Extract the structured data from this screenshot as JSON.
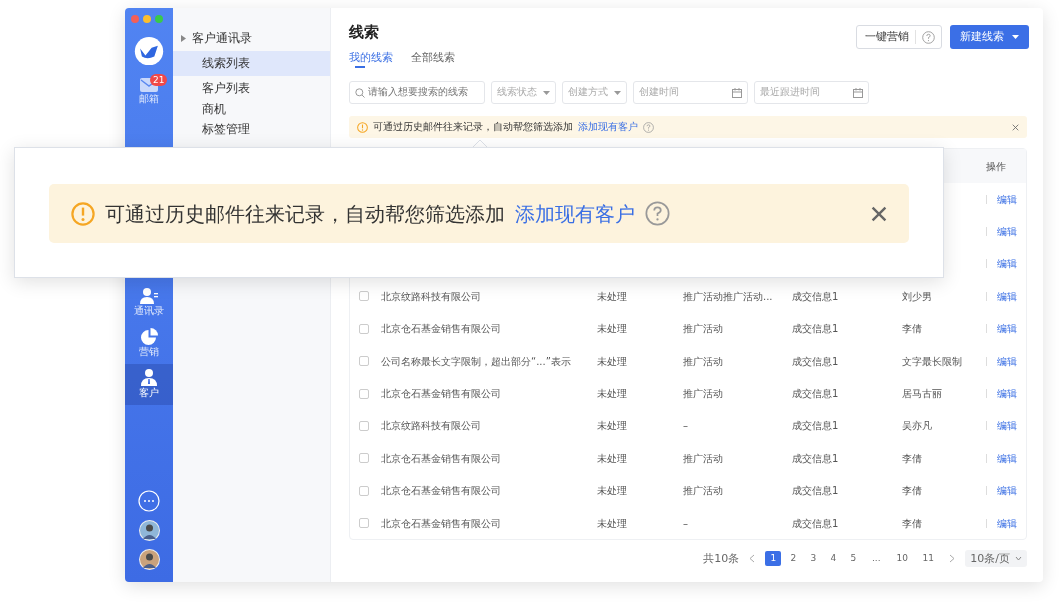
{
  "rail": {
    "items": [
      {
        "kind": "mail",
        "label": "邮箱",
        "badge": "21",
        "selected": false
      },
      {
        "kind": "contacts",
        "label": "通讯录",
        "selected": false
      },
      {
        "kind": "chart",
        "label": "营销",
        "selected": false
      },
      {
        "kind": "customer",
        "label": "客户",
        "selected": true
      }
    ]
  },
  "nav": {
    "group": "客户通讯录",
    "items": [
      {
        "label": "线索列表",
        "selected": true
      },
      {
        "label": "客户列表",
        "selected": false
      },
      {
        "label": "商机",
        "selected": false
      },
      {
        "label": "标签管理",
        "selected": false
      }
    ]
  },
  "page": {
    "title": "线索",
    "marketing_button": "一键营销",
    "create_button": "新建线索",
    "tabs": [
      {
        "label": "我的线索",
        "selected": true
      },
      {
        "label": "全部线索",
        "selected": false
      }
    ],
    "filters": [
      {
        "kind": "search",
        "placeholder": "请输入想要搜索的线索"
      },
      {
        "kind": "select",
        "placeholder": "线索状态"
      },
      {
        "kind": "select",
        "placeholder": "创建方式"
      },
      {
        "kind": "date",
        "placeholder": "创建时间"
      },
      {
        "kind": "date",
        "placeholder": "最近跟进时间"
      }
    ],
    "alert": {
      "text": "可通过历史邮件往来记录，自动帮您筛选添加",
      "link": "添加现有客户"
    }
  },
  "table": {
    "action_column": "操作",
    "rows": [
      {
        "action": "编辑"
      },
      {
        "action": "编辑"
      },
      {
        "action": "编辑"
      },
      {
        "checked": false,
        "cells": [
          "北京纹路科技有限公司",
          "未处理",
          "推广活动推广活动...",
          "成交信息1",
          "刘少男"
        ],
        "action": "编辑"
      },
      {
        "checked": false,
        "cells": [
          "北京仓石基金销售有限公司",
          "未处理",
          "推广活动",
          "成交信息1",
          "李倩"
        ],
        "action": "编辑"
      },
      {
        "checked": false,
        "cells": [
          "公司名称最长文字限制，超出部分“...”表示",
          "未处理",
          "推广活动",
          "成交信息1",
          "文字最长限制"
        ],
        "action": "编辑"
      },
      {
        "checked": false,
        "cells": [
          "北京仓石基金销售有限公司",
          "未处理",
          "推广活动",
          "成交信息1",
          "居马古丽"
        ],
        "action": "编辑"
      },
      {
        "checked": false,
        "cells": [
          "北京纹路科技有限公司",
          "未处理",
          "–",
          "成交信息1",
          "吴亦凡"
        ],
        "action": "编辑"
      },
      {
        "checked": false,
        "cells": [
          "北京仓石基金销售有限公司",
          "未处理",
          "推广活动",
          "成交信息1",
          "李倩"
        ],
        "action": "编辑"
      },
      {
        "checked": false,
        "cells": [
          "北京仓石基金销售有限公司",
          "未处理",
          "推广活动",
          "成交信息1",
          "李倩"
        ],
        "action": "编辑"
      },
      {
        "checked": false,
        "cells": [
          "北京仓石基金销售有限公司",
          "未处理",
          "–",
          "成交信息1",
          "李倩"
        ],
        "action": "编辑"
      }
    ]
  },
  "pagination": {
    "total": "共10条",
    "page_size": "10条/页",
    "pages": [
      {
        "label": "1",
        "selected": true
      },
      {
        "label": "2",
        "selected": false
      },
      {
        "label": "3",
        "selected": false
      },
      {
        "label": "4",
        "selected": false
      },
      {
        "label": "5",
        "selected": false
      },
      {
        "label": "...",
        "selected": false
      },
      {
        "label": "10",
        "selected": false
      },
      {
        "label": "11",
        "selected": false
      }
    ]
  },
  "callout": {
    "text": "可通过历史邮件往来记录，自动帮您筛选添加",
    "link": "添加现有客户"
  }
}
